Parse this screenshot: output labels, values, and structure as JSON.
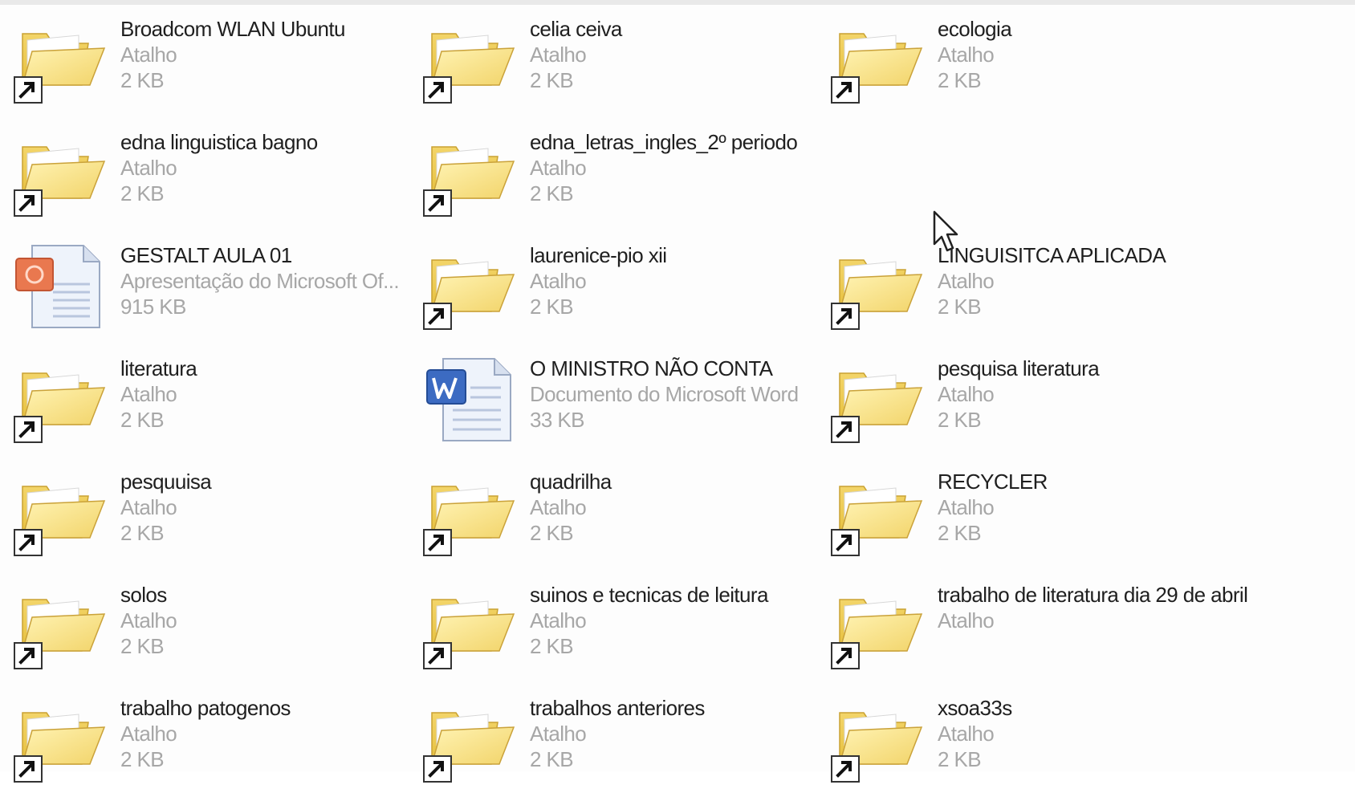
{
  "items": [
    {
      "name": "Broadcom WLAN Ubuntu",
      "type": "Atalho",
      "size": "2 KB",
      "icon": "folder-shortcut-icon",
      "col": 0,
      "row": 0
    },
    {
      "name": "celia ceiva",
      "type": "Atalho",
      "size": "2 KB",
      "icon": "folder-shortcut-icon",
      "col": 1,
      "row": 0
    },
    {
      "name": "ecologia",
      "type": "Atalho",
      "size": "2 KB",
      "icon": "folder-shortcut-icon",
      "col": 2,
      "row": 0
    },
    {
      "name": "edna linguistica bagno",
      "type": "Atalho",
      "size": "2 KB",
      "icon": "folder-shortcut-icon",
      "col": 0,
      "row": 1
    },
    {
      "name": "edna_letras_ingles_2º periodo",
      "type": "Atalho",
      "size": "2 KB",
      "icon": "folder-shortcut-icon",
      "col": 1,
      "row": 1
    },
    {
      "name": "GESTALT AULA 01",
      "type": "Apresentação do Microsoft Of...",
      "size": "915 KB",
      "icon": "powerpoint-file-icon",
      "col": 0,
      "row": 2
    },
    {
      "name": "laurenice-pio xii",
      "type": "Atalho",
      "size": "2 KB",
      "icon": "folder-shortcut-icon",
      "col": 1,
      "row": 2
    },
    {
      "name": "LINGUISITCA APLICADA",
      "type": "Atalho",
      "size": "2 KB",
      "icon": "folder-shortcut-icon",
      "col": 2,
      "row": 2
    },
    {
      "name": "literatura",
      "type": "Atalho",
      "size": "2 KB",
      "icon": "folder-shortcut-icon",
      "col": 0,
      "row": 3
    },
    {
      "name": "O MINISTRO NÃO CONTA",
      "type": "Documento do Microsoft Word",
      "size": "33 KB",
      "icon": "word-file-icon",
      "col": 1,
      "row": 3
    },
    {
      "name": "pesquisa literatura",
      "type": "Atalho",
      "size": "2 KB",
      "icon": "folder-shortcut-icon",
      "col": 2,
      "row": 3
    },
    {
      "name": "pesquuisa",
      "type": "Atalho",
      "size": "2 KB",
      "icon": "folder-shortcut-icon",
      "col": 0,
      "row": 4
    },
    {
      "name": "quadrilha",
      "type": "Atalho",
      "size": "2 KB",
      "icon": "folder-shortcut-icon",
      "col": 1,
      "row": 4
    },
    {
      "name": "RECYCLER",
      "type": "Atalho",
      "size": "2 KB",
      "icon": "folder-shortcut-icon",
      "col": 2,
      "row": 4
    },
    {
      "name": "solos",
      "type": "Atalho",
      "size": "2 KB",
      "icon": "folder-shortcut-icon",
      "col": 0,
      "row": 5
    },
    {
      "name": "suinos e tecnicas de leitura",
      "type": "Atalho",
      "size": "2 KB",
      "icon": "folder-shortcut-icon",
      "col": 1,
      "row": 5
    },
    {
      "name": "trabalho de literatura dia 29 de abril",
      "type": "Atalho",
      "size": "",
      "icon": "folder-shortcut-icon",
      "col": 2,
      "row": 5,
      "wrap": true
    },
    {
      "name": "trabalho patogenos",
      "type": "Atalho",
      "size": "2 KB",
      "icon": "folder-shortcut-icon",
      "col": 0,
      "row": 6
    },
    {
      "name": "trabalhos anteriores",
      "type": "Atalho",
      "size": "2 KB",
      "icon": "folder-shortcut-icon",
      "col": 1,
      "row": 6
    },
    {
      "name": "xsoa33s",
      "type": "Atalho",
      "size": "2 KB",
      "icon": "folder-shortcut-icon",
      "col": 2,
      "row": 6
    }
  ],
  "colors": {
    "name_text": "#1f1f1f",
    "meta_text": "#a7a7a7",
    "folder": "#f7dc6f",
    "background": "#fdfdfd"
  }
}
